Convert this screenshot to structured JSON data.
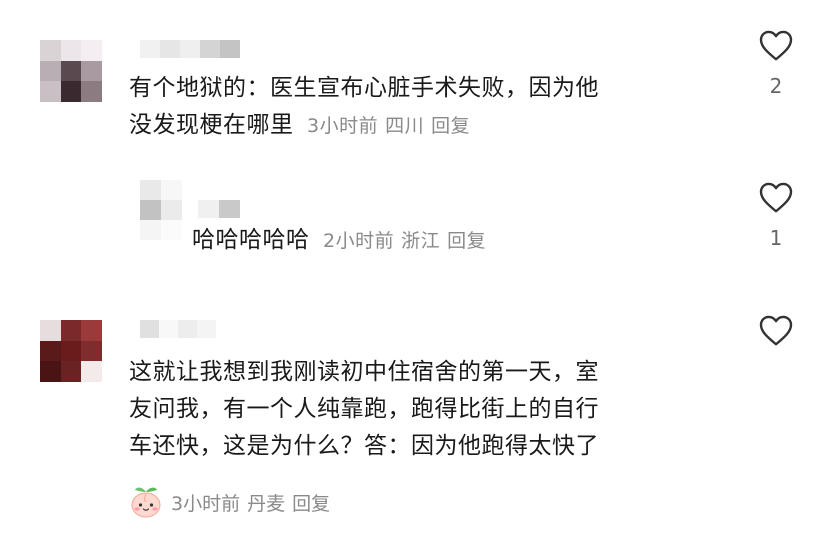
{
  "comments": [
    {
      "text_lines": [
        "有个地狱的：医生宣布心脏手术失败，因为他",
        "没发现梗在哪里"
      ],
      "time": "3小时前",
      "location": "四川",
      "reply_label": "回复",
      "like_count": "2",
      "replies": [
        {
          "text": "哈哈哈哈哈",
          "time": "2小时前",
          "location": "浙江",
          "reply_label": "回复",
          "like_count": "1"
        }
      ]
    },
    {
      "text_lines": [
        "这就让我想到我刚读初中住宿舍的第一天，室",
        "友问我，有一个人纯靠跑，跑得比街上的自行",
        "车还快，这是为什么？答：因为他跑得太快了"
      ],
      "time": "3小时前",
      "location": "丹麦",
      "reply_label": "回复",
      "like_count": ""
    }
  ],
  "icons": {
    "like": "heart-outline-icon",
    "sticker": "peach-face-sticker-icon"
  },
  "colors": {
    "text": "#1a1a1a",
    "meta": "#8a8a8a",
    "icon": "#333333"
  }
}
